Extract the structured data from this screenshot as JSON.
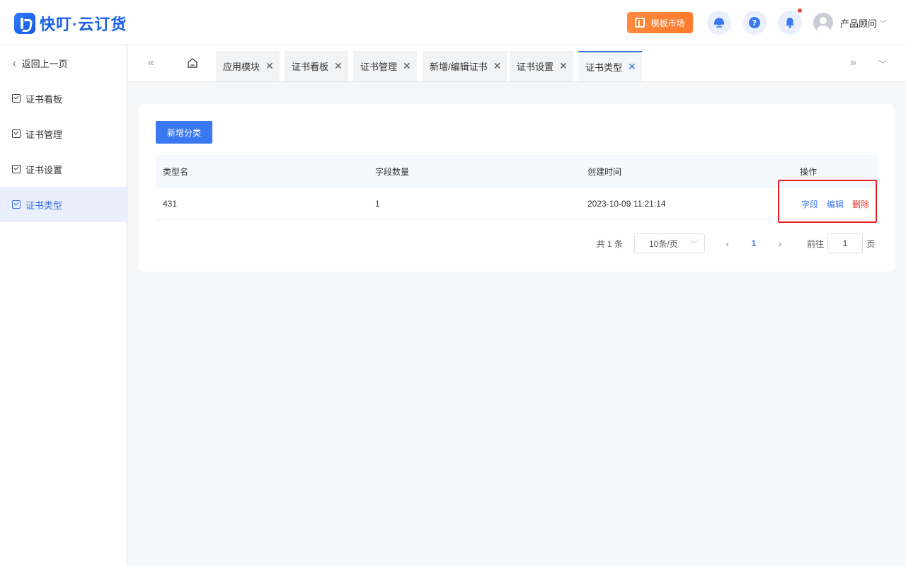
{
  "header": {
    "logo_text": "快叮·云订货",
    "market_label": "模板市场",
    "user_name": "产品顾问",
    "bell_has_dot": true
  },
  "sidebar": {
    "back_label": "返回上一页",
    "items": [
      {
        "label": "证书看板"
      },
      {
        "label": "证书管理"
      },
      {
        "label": "证书设置"
      },
      {
        "label": "证书类型",
        "active": true
      }
    ]
  },
  "tabs": [
    {
      "label": "应用模块"
    },
    {
      "label": "证书看板"
    },
    {
      "label": "证书管理"
    },
    {
      "label": "新增/编辑证书"
    },
    {
      "label": "证书设置"
    },
    {
      "label": "证书类型",
      "active": true
    }
  ],
  "main": {
    "add_button": "新增分类",
    "table": {
      "headers": [
        "类型名",
        "字段数量",
        "创建时间",
        "操作"
      ],
      "rows": [
        {
          "name": "431",
          "field_count": "1",
          "created": "2023-10-09 11:21:14",
          "actions": [
            "字段",
            "编辑",
            "删除"
          ]
        }
      ]
    },
    "pagination": {
      "total": "共 1 条",
      "page_size": "10条/页",
      "current_page": "1",
      "goto_label": "前往",
      "goto_value": "1",
      "page_suffix": "页"
    }
  },
  "colors": {
    "primary": "#3a78f2",
    "danger": "#f0322f",
    "highlight_box": "#e82222",
    "market_orange": "#ff8a3d"
  },
  "icons": [
    "logo-icon",
    "template-icon",
    "customer-service-icon",
    "help-icon",
    "bell-icon",
    "avatar",
    "home-icon",
    "checkbox-icon"
  ]
}
